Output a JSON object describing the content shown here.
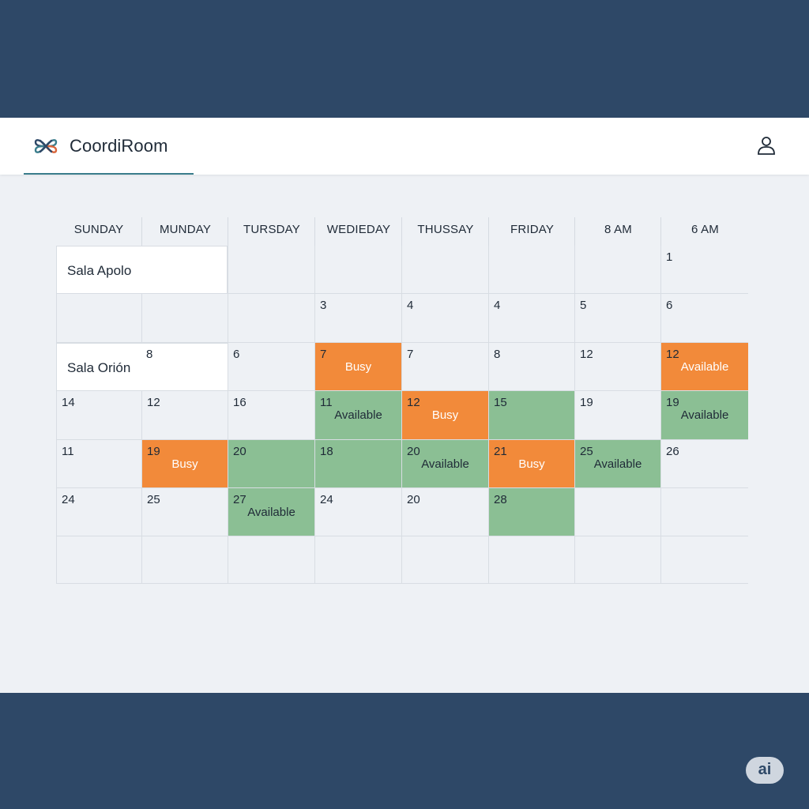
{
  "app": {
    "name": "CoordiRoom",
    "logo_icon": "knot-logo-icon",
    "user_icon": "user-icon"
  },
  "colors": {
    "busy": "#f28a3a",
    "available": "#8bbf94",
    "frame": "#2e4867"
  },
  "calendar": {
    "headers": [
      "SUNDAY",
      "MUNDAY",
      "TURSDAY",
      "WEDIEDAY",
      "THUSSAY",
      "FRIDAY",
      "8 AM",
      "6 AM"
    ],
    "rooms": [
      "Sala Apolo",
      "Sala Orión"
    ],
    "rows": [
      [
        null,
        null,
        null,
        null,
        null,
        null,
        null,
        {
          "num": "1"
        }
      ],
      [
        null,
        null,
        null,
        {
          "num": "3"
        },
        {
          "num": "4"
        },
        {
          "num": "4"
        },
        {
          "num": "5"
        },
        {
          "num": "6"
        }
      ],
      [
        null,
        {
          "num": "8"
        },
        {
          "num": "6"
        },
        {
          "num": "7",
          "state": "busy",
          "label": "Busy"
        },
        {
          "num": "7"
        },
        {
          "num": "8"
        },
        {
          "num": "12"
        },
        {
          "num": "12",
          "state": "busy",
          "label": "Available"
        }
      ],
      [
        {
          "num": "14"
        },
        {
          "num": "12"
        },
        {
          "num": "16"
        },
        {
          "num": "11",
          "state": "avail",
          "label": "Available"
        },
        {
          "num": "12",
          "state": "busy",
          "label": "Busy"
        },
        {
          "num": "15",
          "state": "avail"
        },
        {
          "num": "19"
        },
        {
          "num": "19",
          "state": "avail",
          "label": "Available"
        }
      ],
      [
        {
          "num": "11"
        },
        {
          "num": "19",
          "state": "busy",
          "label": "Busy"
        },
        {
          "num": "20",
          "state": "avail"
        },
        {
          "num": "18",
          "state": "avail"
        },
        {
          "num": "20",
          "state": "avail",
          "label": "Available"
        },
        {
          "num": "21",
          "state": "busy",
          "label": "Busy"
        },
        {
          "num": "25",
          "state": "avail",
          "label": "Available"
        },
        {
          "num": "26"
        }
      ],
      [
        {
          "num": "24"
        },
        {
          "num": "25"
        },
        {
          "num": "27",
          "state": "avail",
          "label": "Available"
        },
        {
          "num": "24"
        },
        {
          "num": "20"
        },
        {
          "num": "28",
          "state": "avail"
        },
        null,
        null
      ],
      [
        null,
        null,
        null,
        null,
        null,
        null,
        null,
        null
      ]
    ]
  },
  "badge": {
    "label": "ai"
  }
}
